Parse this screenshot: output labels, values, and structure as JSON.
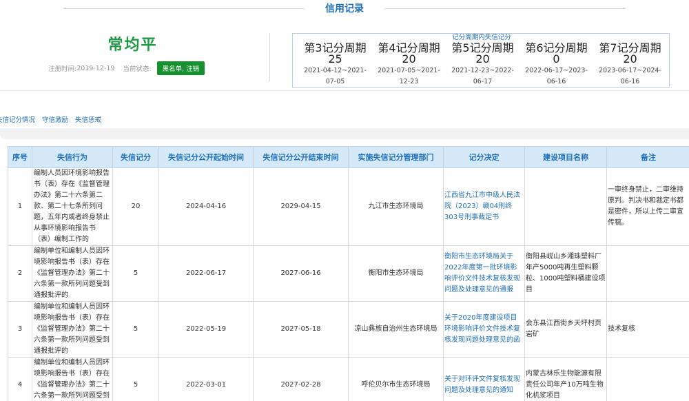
{
  "header": {
    "section_title": "信用记录"
  },
  "person": {
    "name": "常均平",
    "register_label": "注册时间:",
    "register_date": "2019-12-19",
    "status_label": "当前状态:",
    "status": "黑名单, 注销"
  },
  "period_box": {
    "legend": "记分周期内失信记分",
    "periods": [
      {
        "name": "第3记分周期",
        "score": "25",
        "range": "2021-04-12~2021-07-05"
      },
      {
        "name": "第4记分周期",
        "score": "20",
        "range": "2021-07-05~2021-12-23"
      },
      {
        "name": "第5记分周期",
        "score": "20",
        "range": "2021-12-23~2022-06-17"
      },
      {
        "name": "第6记分周期",
        "score": "0",
        "range": "2022-06-17~2023-06-16"
      },
      {
        "name": "第7记分周期",
        "score": "20",
        "range": "2023-06-17~2024-06-16"
      }
    ]
  },
  "tabs": [
    "失信记分情况",
    "守信激励",
    "失信惩戒"
  ],
  "table": {
    "headers": [
      "序号",
      "失信行为",
      "失信记分",
      "失信记分公开起始时间",
      "失信记分公开结束时间",
      "实施失信记分管理部门",
      "记分决定",
      "建设项目名称",
      "备注"
    ],
    "rows": [
      {
        "no": "1",
        "behavior": "编制人员因环境影响报告书（表）存在《监督管理办法》第二十六条第二款、第二十七条所列问题，五年内或者终身禁止从事环境影响报告书（表）编制工作的",
        "score": "20",
        "start": "2024-04-16",
        "end": "2029-04-15",
        "dept": "九江市生态环境局",
        "decision": "江西省九江市中级人民法院（2023）赣04刑终303号刑事裁定书",
        "project": "",
        "note": "一审终身禁止，二审维持原判。判决书和裁定书都是密件，所以上传二审宣传稿。"
      },
      {
        "no": "2",
        "behavior": "编制单位和编制人员因环境影响报告书（表）存在《监督管理办法》第二十六条第一款所列问题受到通报批评的",
        "score": "5",
        "start": "2022-06-17",
        "end": "2027-06-16",
        "dept": "衡阳市生态环境局",
        "decision": "衡阳市生态环境局关于2022年度第一批环境影响评价文件技术复核发现问题及处理意见的通报",
        "project": "衡阳县岘山乡湘珠塑料厂年产5000吨再生塑料颗粒、1000吨塑料桶建设项目",
        "note": ""
      },
      {
        "no": "3",
        "behavior": "编制单位和编制人员因环境影响报告书（表）存在《监督管理办法》第二十六条第一款所列问题受到通报批评的",
        "score": "5",
        "start": "2022-05-19",
        "end": "2027-05-18",
        "dept": "凉山彝族自治州生态环境局",
        "decision": "关于2020年度建设项目环境影响评价文件技术复核发现问题处理意见的函",
        "project": "会东县江西街乡天坪村页岩矿",
        "note": "技术复核"
      },
      {
        "no": "4",
        "behavior": "编制单位和编制人员因环境影响报告书（表）存在《监督管理办法》第二十六条第一款所列问题受到通报批评的",
        "score": "5",
        "start": "2022-03-01",
        "end": "2027-02-28",
        "dept": "呼伦贝尔市生态环境局",
        "decision": "关于对环评文件复核发现问题及处理意见的通知",
        "project": "内蒙古林乐生物能源有限责任公司年产10万吨生物化机浆项目",
        "note": ""
      }
    ]
  }
}
